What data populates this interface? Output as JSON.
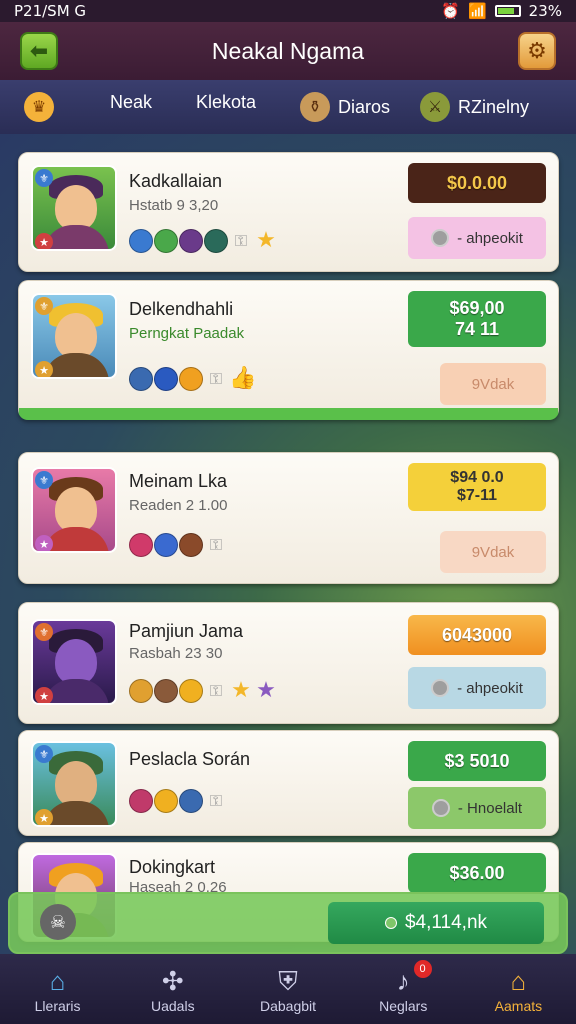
{
  "status_bar": {
    "time": "P21/SM G",
    "battery": "23%"
  },
  "header": {
    "title": "Neakal Ngama"
  },
  "tabs": [
    {
      "label": "Neak"
    },
    {
      "label": "Klekota"
    },
    {
      "label": "Diaros"
    },
    {
      "label": "RZinelny"
    }
  ],
  "cards": [
    {
      "name": "Kadkallaian",
      "sub": "Hstatb 9 3,20",
      "price": "$0.0.00",
      "price_color": "#4a2418",
      "price_text_color": "#f4c84a",
      "action": "- ahpeokit",
      "action_bg": "#f4c2e4"
    },
    {
      "name": "Delkendhahli",
      "sub": "Perngkat Paadak",
      "price": "$69,00",
      "price2": "74 11",
      "price_color": "#3aa84a",
      "action": "9Vdak",
      "action_bg": "#f8d0b4"
    },
    {
      "name": "Meinam Lka",
      "sub": "Readen 2 1.00",
      "price": "$94 0.0",
      "price2": "$7-11",
      "price_color": "#f4d03a",
      "price_text_color": "#333",
      "action": "9Vdak",
      "action_bg": "#f8d8c4"
    },
    {
      "name": "Pamjiun Jama",
      "sub": "Rasbah 23 30",
      "price": "6043000",
      "price_color": "#f5a623",
      "action": "- ahpeokit",
      "action_bg": "#b8d8e4"
    },
    {
      "name": "Peslacla Során",
      "sub": "",
      "price": "$3 5010",
      "price_color": "#3aa84a",
      "action": "- Hnoelalt",
      "action_bg": "#8cc86a"
    },
    {
      "name": "Dokingkart",
      "sub": "Haseah 2 0.26",
      "price": "$36.00",
      "price_color": "#3aa84a"
    }
  ],
  "offer": {
    "label": "$4,114,nk"
  },
  "nav": [
    {
      "label": "Lleraris",
      "icon": "home-icon"
    },
    {
      "label": "Uadals",
      "icon": "nodes-icon"
    },
    {
      "label": "Dabagbit",
      "icon": "shield-icon"
    },
    {
      "label": "Neglars",
      "icon": "bell-icon",
      "badge": "0"
    },
    {
      "label": "Aamats",
      "icon": "shop-icon",
      "active": true
    }
  ]
}
